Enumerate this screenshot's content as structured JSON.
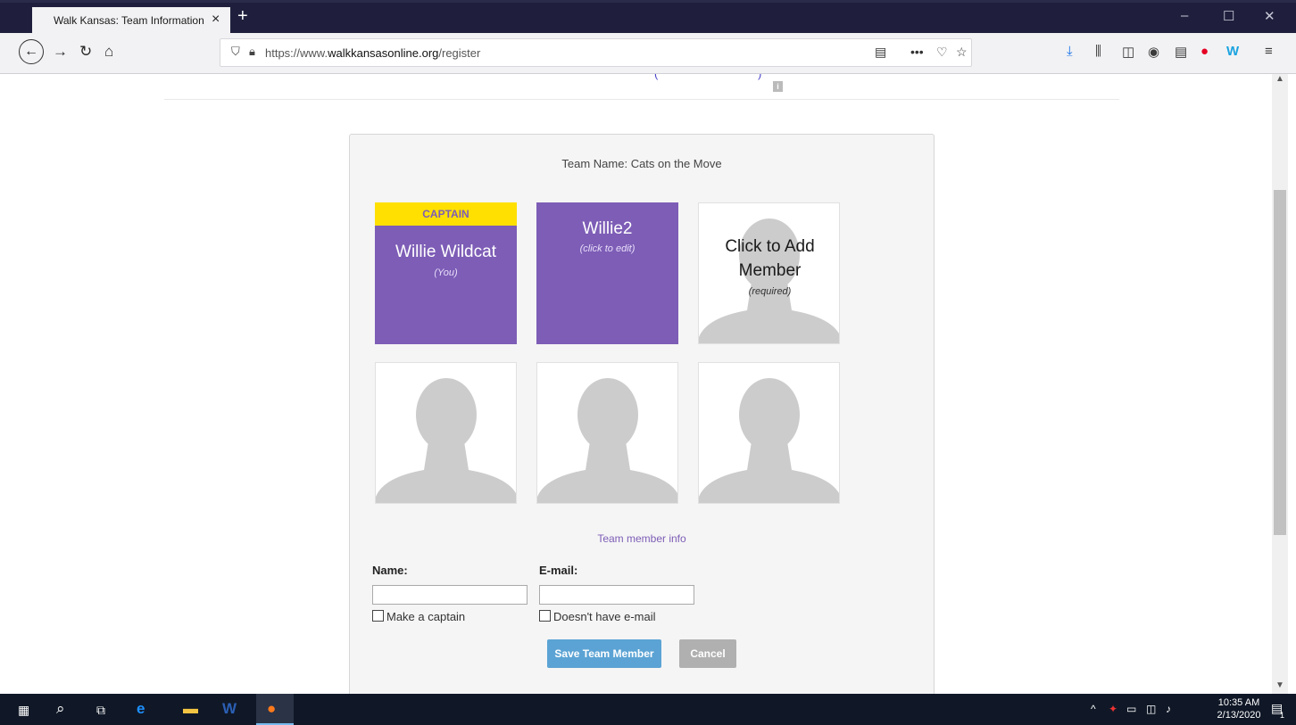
{
  "browser": {
    "tab_title": "Walk Kansas: Team Information",
    "tab_close": "×",
    "new_tab": "+",
    "url_prefix": "https://www.",
    "url_domain": "walkkansasonline.org",
    "url_path": "/register",
    "window_controls": [
      "–",
      "☐",
      "✕"
    ],
    "nav_icons": [
      "back-icon",
      "forward-icon",
      "reload-icon",
      "home-icon"
    ],
    "toolbar_icons": [
      "download-icon",
      "library-icon",
      "sidebar-icon",
      "account-icon",
      "reader-icon",
      "pinterest-icon",
      "w-extension-icon",
      "menu-icon"
    ]
  },
  "page": {
    "top_fragment": "( )",
    "info_badge": "i",
    "team_name": "Team Name: Cats on the Move",
    "members": [
      {
        "badge": "CAPTAIN",
        "name": "Willie Wildcat",
        "sub": "(You)"
      },
      {
        "name": "Willie2",
        "sub": "(click to edit)"
      }
    ],
    "add_member": {
      "title": "Click to Add Member",
      "sub": "(required)"
    },
    "section_label": "Team member info",
    "form": {
      "name_label": "Name:",
      "name_value": "",
      "email_label": "E-mail:",
      "email_value": "",
      "captain_checkbox": "Make a captain",
      "no_email_checkbox": "Doesn't have e-mail",
      "save_button": "Save Team Member",
      "cancel_button": "Cancel"
    }
  },
  "taskbar": {
    "time": "10:35 AM",
    "date": "2/13/2020",
    "notification_count": "1"
  },
  "colors": {
    "accent_purple": "#7d5db6",
    "captain_yellow": "#ffe000",
    "save_blue": "#5ba3d4",
    "cancel_gray": "#b0b0b0"
  }
}
